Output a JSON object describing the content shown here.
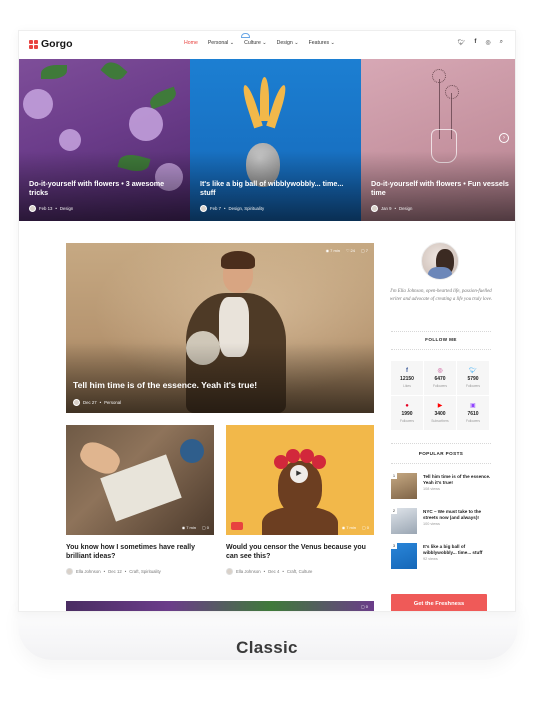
{
  "header": {
    "logo": "Gorgo",
    "nav": [
      {
        "label": "Home",
        "active": true
      },
      {
        "label": "Personal",
        "dropdown": true
      },
      {
        "label": "Culture",
        "dropdown": true
      },
      {
        "label": "Design",
        "dropdown": true
      },
      {
        "label": "Features",
        "dropdown": true
      }
    ],
    "socials": [
      "twitter-icon",
      "facebook-icon",
      "instagram-icon",
      "search-icon"
    ]
  },
  "hero": {
    "slides": [
      {
        "title": "Do-it-yourself with flowers • 3 awesome tricks",
        "date": "Feb 13",
        "category": "Design"
      },
      {
        "title": "It's like a big ball of wibblywobbly... time... stuff",
        "date": "Feb 7",
        "category": "Design, Spirituality"
      },
      {
        "title": "Do-it-yourself with flowers • Fun vessels time",
        "date": "Jan 9",
        "category": "Design"
      }
    ]
  },
  "featured": {
    "title": "Tell him time is of the essence. Yeah it's true!",
    "date": "Dec 27",
    "category": "Personal",
    "stats": {
      "time": "7 min",
      "likes": "24",
      "comments": "7"
    }
  },
  "cards": [
    {
      "title": "You know how I sometimes have really brilliant ideas?",
      "author": "Ella Johnson",
      "date": "Dec 12",
      "category": "Craft, Spirituality",
      "stats": {
        "time": "7 min",
        "comments": "0"
      }
    },
    {
      "title": "Would you censor the Venus because you can see this?",
      "author": "Ella Johnson",
      "date": "Dec 4",
      "category": "Craft, Culture",
      "stats": {
        "time": "7 min",
        "comments": "0"
      }
    }
  ],
  "bottom_strip": {
    "comments": "0"
  },
  "sidebar": {
    "about": "I'm Ella Johnson, open-hearted life, passion-fuelled writer and advocate of creating a life you truly love.",
    "follow_title": "FOLLOW ME",
    "follow": [
      {
        "icon": "facebook-icon",
        "count": "12150",
        "label": "Likes",
        "color": "#3b5998"
      },
      {
        "icon": "instagram-icon",
        "count": "6470",
        "label": "Followers",
        "color": "#c13584"
      },
      {
        "icon": "twitter-icon",
        "count": "5790",
        "label": "Followers",
        "color": "#1da1f2"
      },
      {
        "icon": "pinterest-icon",
        "count": "1990",
        "label": "Followers",
        "color": "#e60023"
      },
      {
        "icon": "youtube-icon",
        "count": "3400",
        "label": "Subscribers",
        "color": "#ff0000"
      },
      {
        "icon": "twitch-icon",
        "count": "7610",
        "label": "Followers",
        "color": "#9146ff"
      }
    ],
    "popular_title": "POPULAR POSTS",
    "popular": [
      {
        "num": "1",
        "title": "Tell him time is of the essence. Yeah it's true!",
        "views": "108 views"
      },
      {
        "num": "2",
        "title": "NYC – We must take to the streets now (and always)!",
        "views": "100 views"
      },
      {
        "num": "3",
        "title": "It's like a big ball of wibblywobbly... time... stuff",
        "views": "92 views"
      }
    ],
    "cta": "Get the Freshness"
  },
  "caption": "Classic",
  "colors": {
    "accent": "#e8423f",
    "cta": "#ef5a58"
  }
}
